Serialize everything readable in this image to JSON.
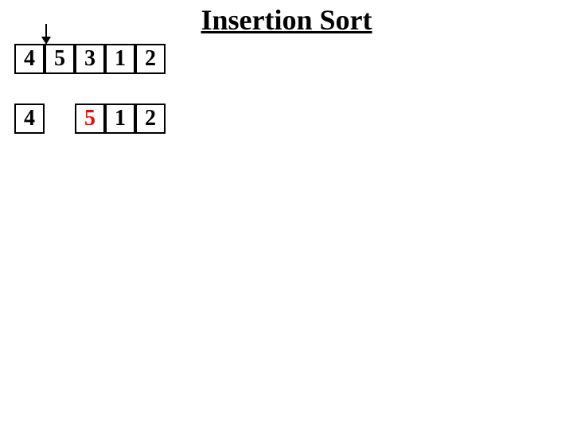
{
  "title": "Insertion Sort",
  "row1": {
    "cells": [
      {
        "value": "4",
        "highlighted": false
      },
      {
        "value": "5",
        "highlighted": false
      },
      {
        "value": "3",
        "highlighted": false
      },
      {
        "value": "1",
        "highlighted": false
      },
      {
        "value": "2",
        "highlighted": false
      }
    ]
  },
  "row2": {
    "cells": [
      {
        "value": "4",
        "highlighted": false,
        "gap": false
      },
      {
        "value": "",
        "highlighted": false,
        "gap": true
      },
      {
        "value": "5",
        "highlighted": true,
        "gap": false
      },
      {
        "value": "1",
        "highlighted": false,
        "gap": false
      },
      {
        "value": "2",
        "highlighted": false,
        "gap": false
      }
    ]
  },
  "colors": {
    "highlighted": "#ff0000",
    "normal": "#000000",
    "background": "#ffffff"
  }
}
